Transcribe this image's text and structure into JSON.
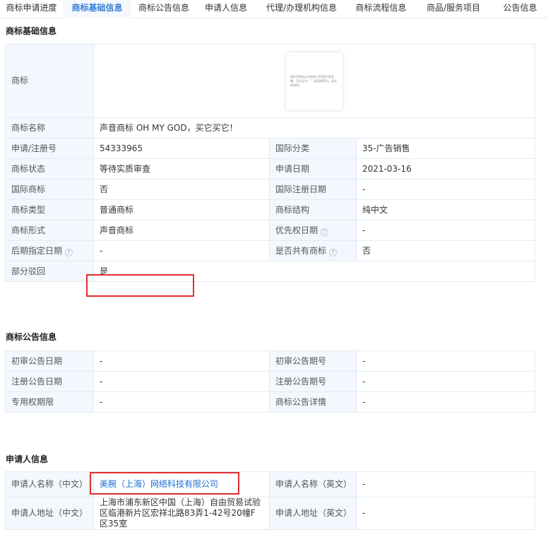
{
  "tabs": [
    {
      "label": "商标申请进度"
    },
    {
      "label": "商标基础信息"
    },
    {
      "label": "商标公告信息"
    },
    {
      "label": "申请人信息"
    },
    {
      "label": "代理/办理机构信息"
    },
    {
      "label": "商标流程信息"
    },
    {
      "label": "商品/服务项目"
    },
    {
      "label": "公告信息"
    }
  ],
  "basic": {
    "title": "商标基础信息",
    "mark_label": "商标",
    "mark_image_text": "接声音商标从开始到人声音说“欧买嘎，买它买它！”，配背景音乐。设计的独特。",
    "name_label": "商标名称",
    "name_value": "声音商标 OH MY GOD，买它买它！",
    "reg_no_label": "申请/注册号",
    "reg_no_value": "54333965",
    "intl_class_label": "国际分类",
    "intl_class_value": "35-广告销售",
    "status_label": "商标状态",
    "status_value": "等待实质审查",
    "apply_date_label": "申请日期",
    "apply_date_value": "2021-03-16",
    "intl_mark_label": "国际商标",
    "intl_mark_value": "否",
    "intl_reg_date_label": "国际注册日期",
    "intl_reg_date_value": "-",
    "type_label": "商标类型",
    "type_value": "普通商标",
    "structure_label": "商标结构",
    "structure_value": "纯中文",
    "form_label": "商标形式",
    "form_value": "声音商标",
    "priority_date_label": "优先权日期",
    "priority_date_value": "-",
    "later_date_label": "后期指定日期",
    "later_date_value": "-",
    "shared_label": "是否共有商标",
    "shared_value": "否",
    "partial_reject_label": "部分驳回",
    "partial_reject_value": "是"
  },
  "announcement": {
    "title": "商标公告信息",
    "prelim_date_label": "初审公告日期",
    "prelim_date_value": "-",
    "prelim_no_label": "初审公告期号",
    "prelim_no_value": "-",
    "reg_date_label": "注册公告日期",
    "reg_date_value": "-",
    "reg_no_label": "注册公告期号",
    "reg_no_value": "-",
    "period_label": "专用权期限",
    "period_value": "-",
    "detail_label": "商标公告详情",
    "detail_value": "-"
  },
  "applicant": {
    "title": "申请人信息",
    "name_cn_label": "申请人名称（中文）",
    "name_cn_value": "美腕（上海）网络科技有限公司",
    "name_en_label": "申请人名称（英文）",
    "name_en_value": "-",
    "addr_cn_label": "申请人地址（中文）",
    "addr_cn_value": "上海市浦东新区中国（上海）自由贸易试验区临港新片区宏祥北路83弄1-42号20幢F区35室",
    "addr_en_label": "申请人地址（英文）",
    "addr_en_value": "-"
  },
  "colors": {
    "accent": "#3a7fd5",
    "label_bg": "#f2f8fd",
    "border": "#e3ebf3",
    "highlight_red": "#e12e2e",
    "link": "#1a6fd1"
  }
}
